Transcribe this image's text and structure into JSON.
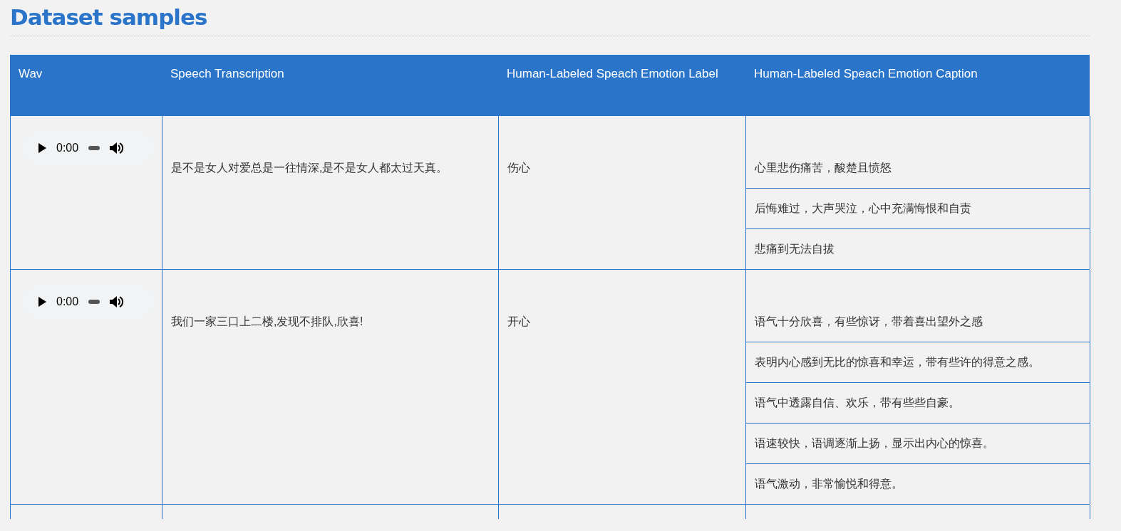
{
  "title": "Dataset samples",
  "table": {
    "columns": [
      "Wav",
      "Speech Transcription",
      "Human-Labeled Speach Emotion Label",
      "Human-Labeled Speach Emotion Caption"
    ],
    "rows": [
      {
        "wav": {
          "time": "0:00"
        },
        "transcription": "是不是女人对爱总是一往情深,是不是女人都太过天真。",
        "label": "伤心",
        "captions": [
          "心里悲伤痛苦，酸楚且愤怒",
          "后悔难过，大声哭泣，心中充满悔恨和自责",
          "悲痛到无法自拔"
        ]
      },
      {
        "wav": {
          "time": "0:00"
        },
        "transcription": "我们一家三口上二楼,发现不排队,欣喜!",
        "label": "开心",
        "captions": [
          "语气十分欣喜，有些惊讶，带着喜出望外之感",
          "表明内心感到无比的惊喜和幸运，带有些许的得意之感。",
          "语气中透露自信、欢乐，带有些些自豪。",
          "语速较快，语调逐渐上扬，显示出内心的惊喜。",
          "语气激动，非常愉悦和得意。"
        ]
      }
    ]
  }
}
